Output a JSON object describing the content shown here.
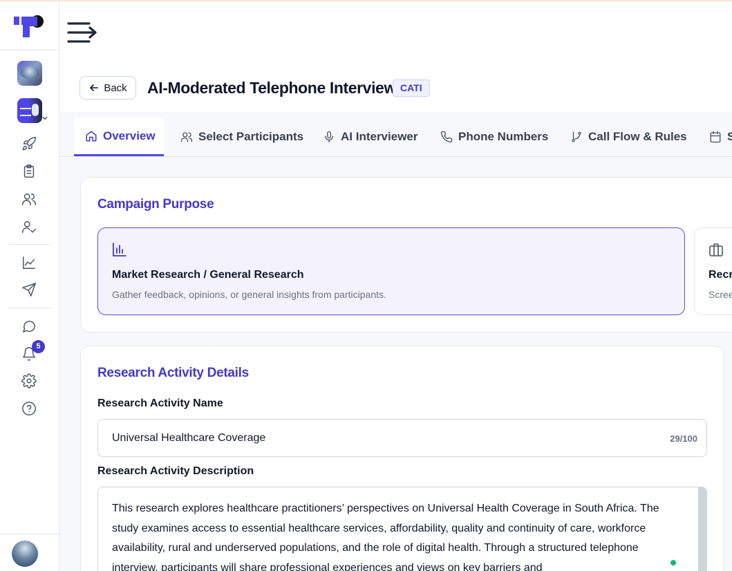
{
  "sidebar": {
    "notifications_count": "5",
    "icons": [
      "rocket-icon",
      "clipboard-icon",
      "users-icon",
      "user-check-icon",
      "chart-line-icon",
      "send-icon",
      "chat-icon",
      "bell-icon",
      "settings-icon",
      "help-icon"
    ]
  },
  "header": {
    "back_label": "Back",
    "title": "AI-Moderated Telephone Interview",
    "tag": "CATI"
  },
  "tabs": [
    {
      "label": "Overview",
      "icon": "home-icon",
      "active": true
    },
    {
      "label": "Select Participants",
      "icon": "users-icon"
    },
    {
      "label": "AI Interviewer",
      "icon": "mic-icon"
    },
    {
      "label": "Phone Numbers",
      "icon": "phone-icon"
    },
    {
      "label": "Call Flow & Rules",
      "icon": "branch-icon"
    },
    {
      "label": "S",
      "icon": "calendar-icon"
    }
  ],
  "campaign_purpose": {
    "title": "Campaign Purpose",
    "options": [
      {
        "title": "Market Research / General Research",
        "description": "Gather feedback, opinions, or general insights from participants.",
        "icon": "bar-chart-icon",
        "selected": true
      },
      {
        "title": "Recr",
        "description": "Scree",
        "icon": "briefcase-icon",
        "selected": false
      }
    ]
  },
  "research_details": {
    "title": "Research Activity Details",
    "name_label": "Research Activity Name",
    "name_value": "Universal Healthcare Coverage",
    "name_count": "29/100",
    "description_label": "Research Activity Description",
    "description_value": "This research explores healthcare practitioners’ perspectives on Universal Health Coverage in South Africa. The study examines access to essential healthcare services, affordability, quality and continuity of care, workforce availability, rural and underserved populations, and the role of digital health. Through a structured telephone interview, participants will share professional experiences and views on key barriers and"
  },
  "colors": {
    "accent": "#4f46e5",
    "accent_text": "#4338ca",
    "selected_bg": "#f3f2fd"
  }
}
